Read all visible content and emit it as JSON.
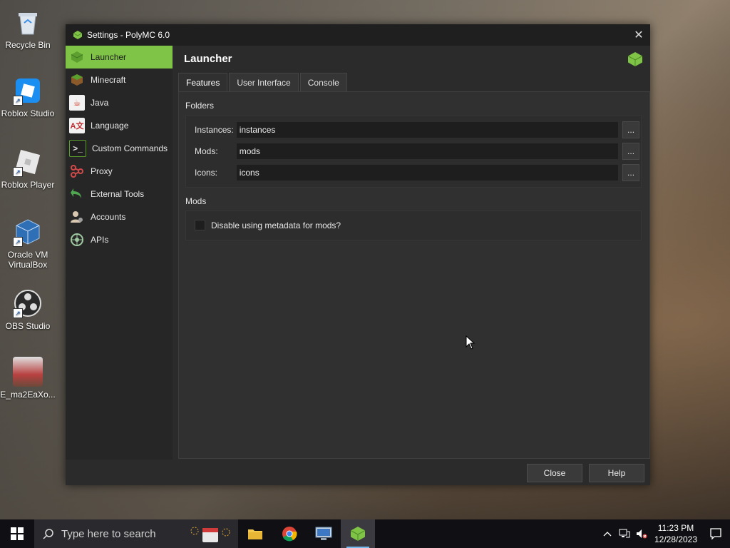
{
  "desktop": {
    "icons": [
      {
        "label": "Recycle Bin",
        "icon": "recycle-bin-icon"
      },
      {
        "label": "Roblox Studio",
        "icon": "roblox-studio-icon"
      },
      {
        "label": "Roblox Player",
        "icon": "roblox-player-icon"
      },
      {
        "label": "Oracle VM VirtualBox",
        "icon": "virtualbox-icon"
      },
      {
        "label": "OBS Studio",
        "icon": "obs-studio-icon"
      },
      {
        "label": "E_ma2EaXo...",
        "icon": "image-file-icon"
      }
    ]
  },
  "window": {
    "title": "Settings - PolyMC 6.0",
    "close_glyph": "✕"
  },
  "sidebar": {
    "items": [
      {
        "label": "Launcher",
        "icon": "polymc-icon",
        "active": true
      },
      {
        "label": "Minecraft",
        "icon": "minecraft-block-icon"
      },
      {
        "label": "Java",
        "icon": "java-icon"
      },
      {
        "label": "Language",
        "icon": "language-icon"
      },
      {
        "label": "Custom Commands",
        "icon": "terminal-icon"
      },
      {
        "label": "Proxy",
        "icon": "proxy-icon"
      },
      {
        "label": "External Tools",
        "icon": "external-tools-icon"
      },
      {
        "label": "Accounts",
        "icon": "accounts-icon"
      },
      {
        "label": "APIs",
        "icon": "api-icon"
      }
    ]
  },
  "content": {
    "title": "Launcher",
    "tabs": [
      {
        "label": "Features",
        "active": true
      },
      {
        "label": "User Interface"
      },
      {
        "label": "Console"
      }
    ],
    "folders": {
      "heading": "Folders",
      "rows": [
        {
          "label": "Instances:",
          "value": "instances"
        },
        {
          "label": "Mods:",
          "value": "mods"
        },
        {
          "label": "Icons:",
          "value": "icons"
        }
      ],
      "browse_label": "..."
    },
    "mods": {
      "heading": "Mods",
      "checkbox_label": "Disable using metadata for mods?",
      "checked": false
    }
  },
  "footer": {
    "close_label": "Close",
    "help_label": "Help"
  },
  "taskbar": {
    "search_placeholder": "Type here to search",
    "apps": [
      "file-explorer-icon",
      "chrome-icon",
      "remote-desktop-icon",
      "polymc-icon"
    ],
    "time": "11:23 PM",
    "date": "12/28/2023"
  },
  "colors": {
    "accent": "#7fc347",
    "window_bg": "#2b2b2b",
    "taskbar_bg": "#101014"
  }
}
